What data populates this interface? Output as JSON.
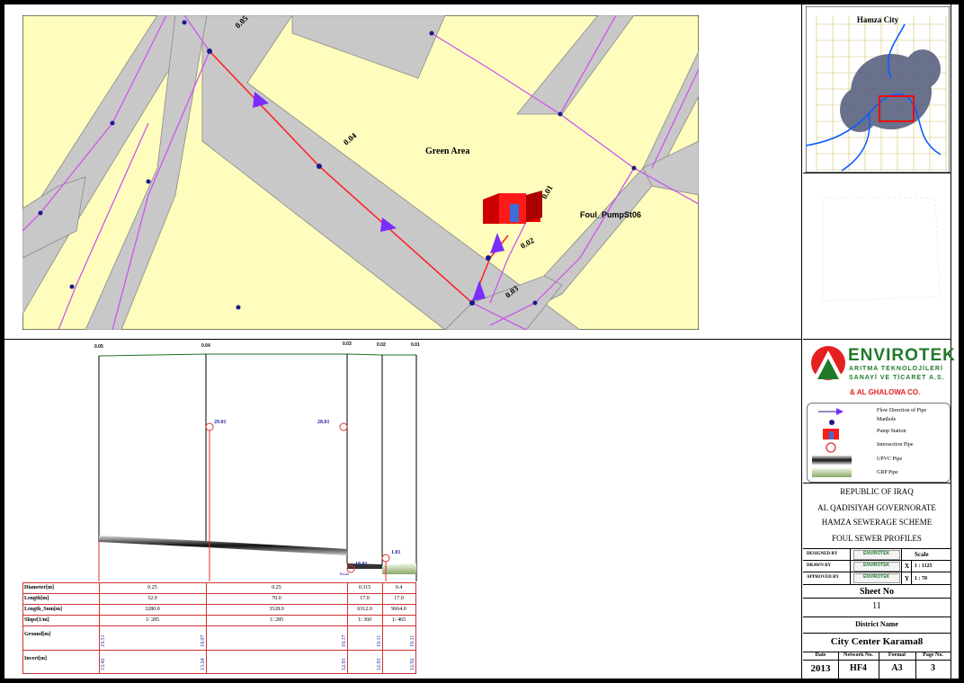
{
  "map": {
    "area_label": "Green Area",
    "pump_label": "Foul_PumpSt06",
    "pipe_labels": [
      "0.05",
      "0.04",
      "0.01",
      "0.02",
      "0.03"
    ]
  },
  "profile": {
    "node_labels": [
      "0.05",
      "0.04",
      "0.03",
      "0.02",
      "0.01"
    ],
    "levels": [
      "29.01",
      "28.01",
      "18.01",
      "1.01"
    ],
    "junction_label": "Rasuh",
    "rows": [
      {
        "label": "Diameter[m]",
        "values": [
          "0.25",
          "0.25",
          "0.315",
          "0.4"
        ]
      },
      {
        "label": "Length[m]",
        "values": [
          "52.0",
          "70.0",
          "17.0",
          "17.0"
        ]
      },
      {
        "label": "Length_Sum[m]",
        "values": [
          "3280.0",
          "3528.0",
          "6312.0",
          "9664.0"
        ]
      },
      {
        "label": "Slope[1/m]",
        "values": [
          "1/ 285",
          "1/ 285",
          "1/ 360",
          "1/ 465"
        ]
      }
    ],
    "ground_label": "Ground[m]",
    "ground_values": [
      "19.51",
      "19.07",
      "19.17",
      "19.11",
      "19.11"
    ],
    "invert_label": "Invert[m]",
    "invert_values": [
      "13.42",
      "13.24",
      "12.93",
      "12.93",
      "12.92"
    ]
  },
  "keymap": {
    "title": "Hamza City"
  },
  "company": {
    "name": "ENVIROTEK",
    "line1": "ARITMA TEKNOLOJİLERİ",
    "line2": "SANAYİ VE TİCARET A.S.",
    "partner": "& AL GHALOWA CO."
  },
  "legend": [
    {
      "icon": "flow-direction",
      "label": "Flow Direction of Pipe"
    },
    {
      "icon": "manhole",
      "label": "Manhole"
    },
    {
      "icon": "pump-station",
      "label": "Pump Station"
    },
    {
      "icon": "intersection-pipe",
      "label": "Intersection Pipe"
    },
    {
      "icon": "upvc-pipe",
      "label": "UPVC Pipe"
    },
    {
      "icon": "grp-pipe",
      "label": "GRP Pipe"
    }
  ],
  "project": {
    "republic": "REPUBLIC OF IRAQ",
    "governorate": "AL QADISIYAH GOVERNORATE",
    "scheme": "HAMZA SEWERAGE SCHEME",
    "drawing": "FOUL SEWER PROFILES"
  },
  "signoff": {
    "designed_by": "DESIGNED BY",
    "drawn_by": "DRAWN   BY",
    "approved_by": "APPROVED BY",
    "stamp": "ENVIROTEK",
    "scale_label": "Scale",
    "x_label": "X",
    "x_value": "1 : 1125",
    "y_label": "Y",
    "y_value": "1 : 70"
  },
  "sheet": {
    "label": "Sheet No",
    "value": "11"
  },
  "district": {
    "label": "District Name",
    "value": "City Center  Karama8"
  },
  "footer": {
    "headers": [
      "Date",
      "Network No.",
      "Format",
      "Page No."
    ],
    "values": [
      "2013",
      "HF4",
      "A3",
      "3"
    ]
  }
}
